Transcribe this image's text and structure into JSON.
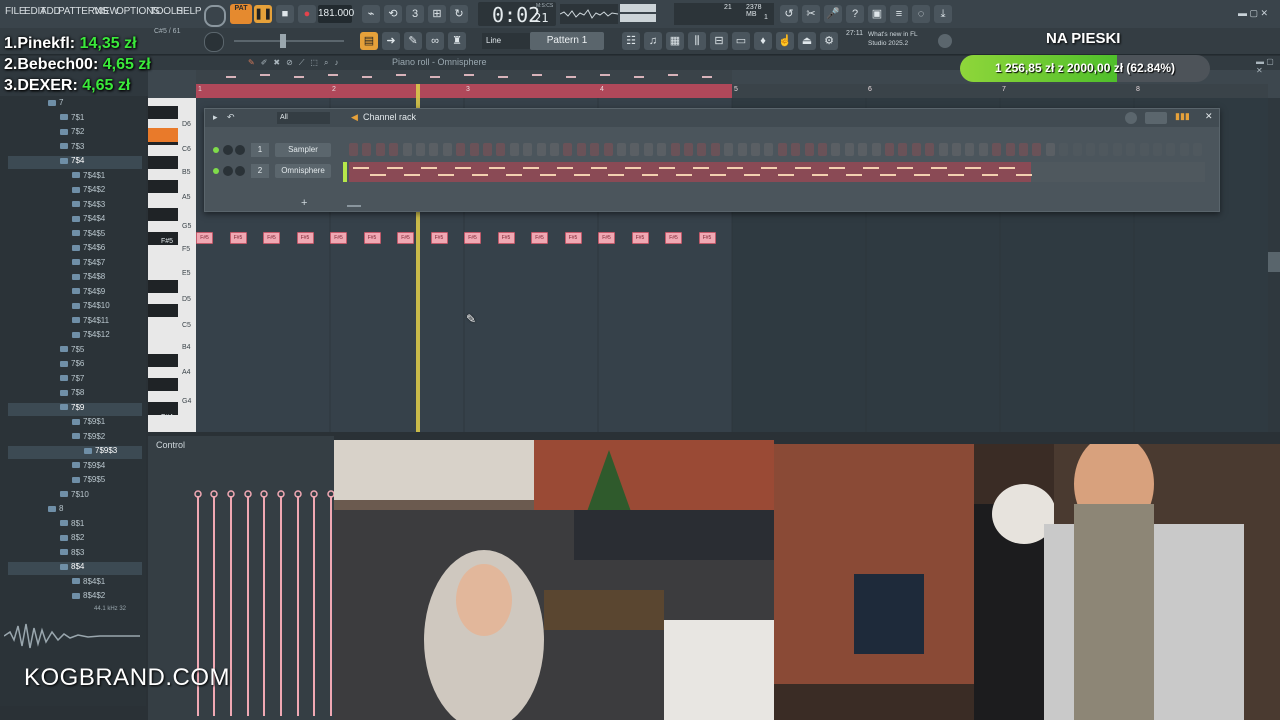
{
  "menu": [
    "FILE",
    "EDIT",
    "ADD",
    "PATTERNS",
    "VIEW",
    "OPTIONS",
    "TOOLS",
    "HELP"
  ],
  "transport": {
    "pat_label": "PAT",
    "tempo": "181.000",
    "time": "0:02",
    "time_sub": "21",
    "time_unit": "M:S:CS",
    "cpu": "21",
    "memory": "2378 MB",
    "memory_sub": "1"
  },
  "toolbar2": {
    "snap": "Line",
    "pattern": "Pattern 1",
    "news_time": "27:11",
    "news_text": "What's new in FL Studio 2025.2",
    "hint": "C#5 / 61"
  },
  "leaderboard": [
    {
      "rank": "1.",
      "name": "Pinekfl:",
      "amount": "14,35 zł"
    },
    {
      "rank": "2.",
      "name": "Bebech00:",
      "amount": "4,65 zł"
    },
    {
      "rank": "3.",
      "name": "DEXER:",
      "amount": "4,65 zł"
    }
  ],
  "goal": {
    "title": "NA PIESKI",
    "text": "1 256,85 zł z 2000,00 zł (62.84%)",
    "progress": 0.6284
  },
  "browser": {
    "items": [
      {
        "label": "7",
        "indent": 0,
        "sel": false
      },
      {
        "label": "7$1",
        "indent": 1,
        "sel": false
      },
      {
        "label": "7$2",
        "indent": 1,
        "sel": false
      },
      {
        "label": "7$3",
        "indent": 1,
        "sel": false
      },
      {
        "label": "7$4",
        "indent": 1,
        "sel": true
      },
      {
        "label": "7$4$1",
        "indent": 2,
        "sel": false
      },
      {
        "label": "7$4$2",
        "indent": 2,
        "sel": false
      },
      {
        "label": "7$4$3",
        "indent": 2,
        "sel": false
      },
      {
        "label": "7$4$4",
        "indent": 2,
        "sel": false
      },
      {
        "label": "7$4$5",
        "indent": 2,
        "sel": false
      },
      {
        "label": "7$4$6",
        "indent": 2,
        "sel": false
      },
      {
        "label": "7$4$7",
        "indent": 2,
        "sel": false
      },
      {
        "label": "7$4$8",
        "indent": 2,
        "sel": false
      },
      {
        "label": "7$4$9",
        "indent": 2,
        "sel": false
      },
      {
        "label": "7$4$10",
        "indent": 2,
        "sel": false
      },
      {
        "label": "7$4$11",
        "indent": 2,
        "sel": false
      },
      {
        "label": "7$4$12",
        "indent": 2,
        "sel": false
      },
      {
        "label": "7$5",
        "indent": 1,
        "sel": false
      },
      {
        "label": "7$6",
        "indent": 1,
        "sel": false
      },
      {
        "label": "7$7",
        "indent": 1,
        "sel": false
      },
      {
        "label": "7$8",
        "indent": 1,
        "sel": false
      },
      {
        "label": "7$9",
        "indent": 1,
        "sel": true
      },
      {
        "label": "7$9$1",
        "indent": 2,
        "sel": false
      },
      {
        "label": "7$9$2",
        "indent": 2,
        "sel": false
      },
      {
        "label": "7$9$3",
        "indent": 3,
        "sel": true
      },
      {
        "label": "7$9$4",
        "indent": 2,
        "sel": false
      },
      {
        "label": "7$9$5",
        "indent": 2,
        "sel": false
      },
      {
        "label": "7$10",
        "indent": 1,
        "sel": false
      },
      {
        "label": "8",
        "indent": 0,
        "sel": false
      },
      {
        "label": "8$1",
        "indent": 1,
        "sel": false
      },
      {
        "label": "8$2",
        "indent": 1,
        "sel": false
      },
      {
        "label": "8$3",
        "indent": 1,
        "sel": false
      },
      {
        "label": "8$4",
        "indent": 1,
        "sel": true
      },
      {
        "label": "8$4$1",
        "indent": 2,
        "sel": false
      },
      {
        "label": "8$4$2",
        "indent": 2,
        "sel": false
      }
    ],
    "sample_info": "44.1 kHz 32"
  },
  "piano_roll": {
    "title": "Piano roll - Omnisphere",
    "bars": [
      "1",
      "2",
      "3",
      "4",
      "5",
      "6",
      "7",
      "8"
    ],
    "keys": [
      "D6",
      "C6",
      "B5",
      "A5",
      "G5",
      "F#5",
      "F5",
      "E5",
      "D5",
      "C5",
      "B4",
      "A4",
      "G4",
      "F#4"
    ],
    "note_label": "F#5",
    "note_count": 16
  },
  "channel_rack": {
    "title": "Channel rack",
    "filter": "All",
    "channels": [
      {
        "num": "1",
        "name": "Sampler"
      },
      {
        "num": "2",
        "name": "Omnisphere"
      }
    ],
    "add": "+"
  },
  "control": {
    "label": "Control"
  },
  "watermark": "KOGBRAND.COM"
}
